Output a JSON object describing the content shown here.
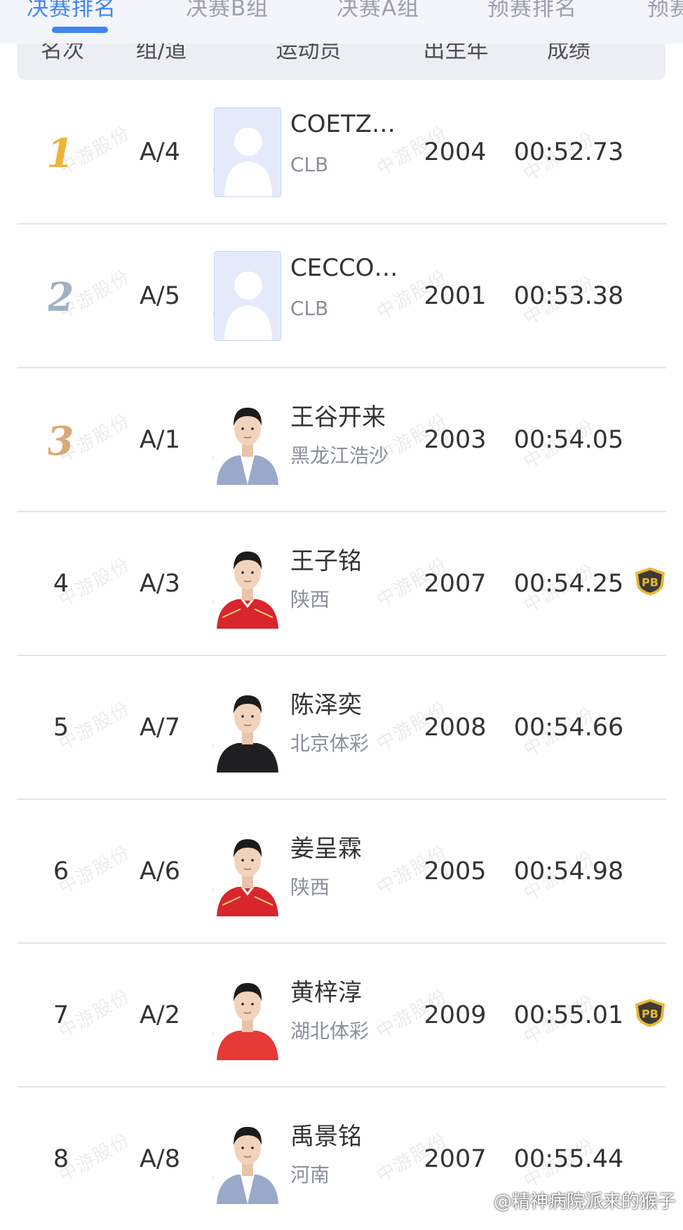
{
  "tabs": [
    {
      "label": "决赛排名",
      "active": true
    },
    {
      "label": "决赛B组",
      "active": false
    },
    {
      "label": "决赛A组",
      "active": false
    },
    {
      "label": "预赛排名",
      "active": false
    },
    {
      "label": "预赛",
      "active": false
    }
  ],
  "header": {
    "rank": "名次",
    "lane": "组/道",
    "athlete": "运动员",
    "birth_year": "出生年",
    "result": "成绩"
  },
  "rows": [
    {
      "rank": "1",
      "medal": "gold",
      "lane": "A/4",
      "name": "COETZ…",
      "team": "CLB",
      "year": "2004",
      "result": "00:52.73",
      "pb": false,
      "photo": "placeholder"
    },
    {
      "rank": "2",
      "medal": "silver",
      "lane": "A/5",
      "name": "CECCO…",
      "team": "CLB",
      "year": "2001",
      "result": "00:53.38",
      "pb": false,
      "photo": "placeholder"
    },
    {
      "rank": "3",
      "medal": "bronze",
      "lane": "A/1",
      "name": "王谷开来",
      "team": "黑龙江浩沙",
      "year": "2003",
      "result": "00:54.05",
      "pb": false,
      "photo": "suit"
    },
    {
      "rank": "4",
      "medal": "",
      "lane": "A/3",
      "name": "王子铭",
      "team": "陕西",
      "year": "2007",
      "result": "00:54.25",
      "pb": true,
      "photo": "red-jacket"
    },
    {
      "rank": "5",
      "medal": "",
      "lane": "A/7",
      "name": "陈泽奕",
      "team": "北京体彩",
      "year": "2008",
      "result": "00:54.66",
      "pb": false,
      "photo": "dark-shirt"
    },
    {
      "rank": "6",
      "medal": "",
      "lane": "A/6",
      "name": "姜呈霖",
      "team": "陕西",
      "year": "2005",
      "result": "00:54.98",
      "pb": false,
      "photo": "red-jacket"
    },
    {
      "rank": "7",
      "medal": "",
      "lane": "A/2",
      "name": "黄梓淳",
      "team": "湖北体彩",
      "year": "2009",
      "result": "00:55.01",
      "pb": true,
      "photo": "red-shirt"
    },
    {
      "rank": "8",
      "medal": "",
      "lane": "A/8",
      "name": "禹景铭",
      "team": "河南",
      "year": "2007",
      "result": "00:55.44",
      "pb": false,
      "photo": "suit"
    }
  ],
  "pb_label": "PB",
  "watermark_text": "中游股份",
  "credit": "@精神病院派来的猴子",
  "colors": {
    "accent": "#3f86ee",
    "gold": "#f0b23a",
    "silver": "#9fb1c6",
    "bronze": "#d9a978",
    "pb_gold": "#e8b73a",
    "red_jacket": "#d8262c"
  }
}
